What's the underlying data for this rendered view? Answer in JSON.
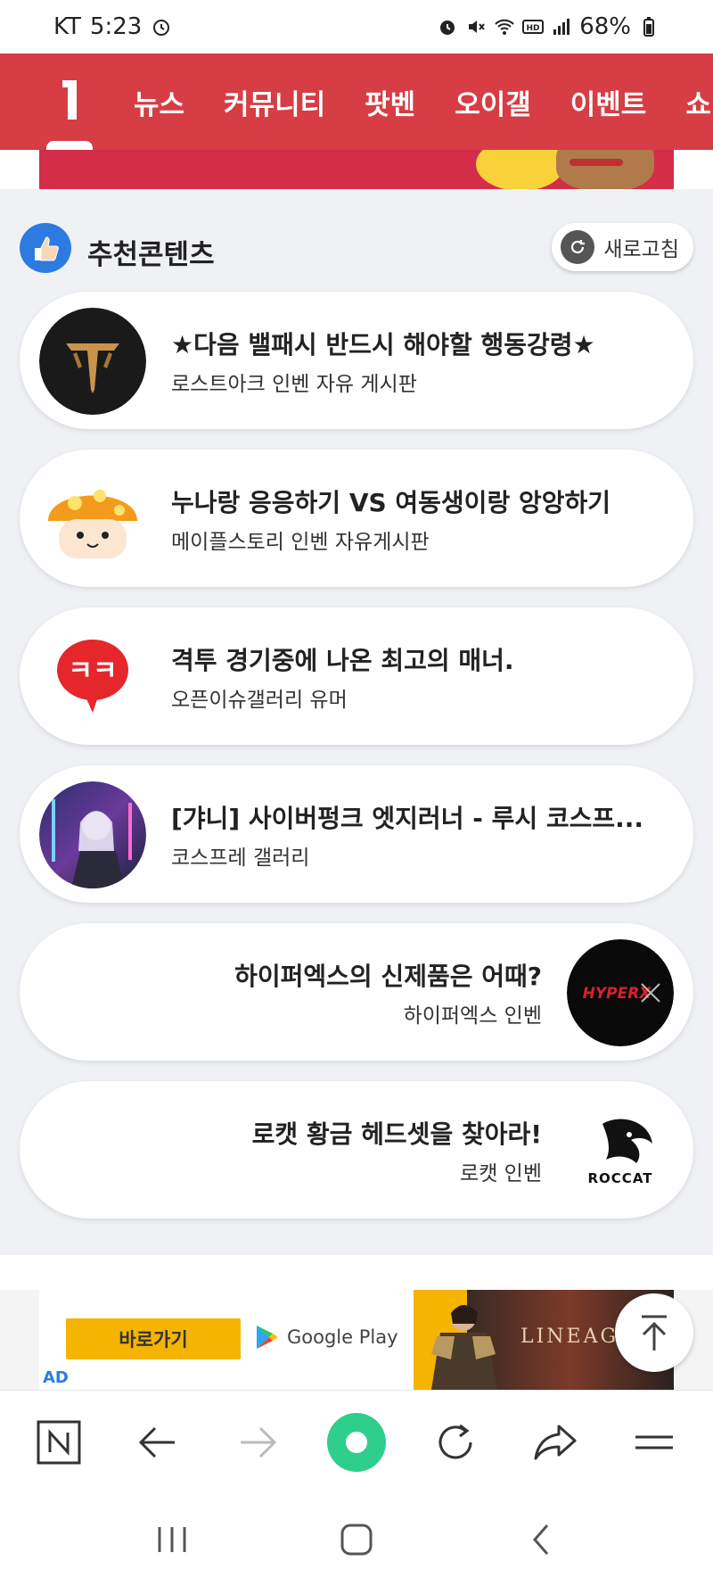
{
  "status_bar": {
    "carrier": "KT",
    "time": "5:23",
    "battery": "68%"
  },
  "nav": {
    "items": [
      "뉴스",
      "커뮤니티",
      "팟벤",
      "오이갤",
      "이벤트",
      "쇼"
    ]
  },
  "recommend": {
    "title": "추천콘텐츠",
    "refresh_label": "새로고침",
    "cards": [
      {
        "title": "★다음 밸패시 반드시 해야할 행동강령★",
        "source": "로스트아크 인벤 자유 게시판"
      },
      {
        "title": "누나랑 응응하기 VS 여동생이랑 앙앙하기",
        "source": "메이플스토리 인벤 자유게시판"
      },
      {
        "title": "격투 경기중에 나온 최고의 매너.",
        "source": "오픈이슈갤러리 유머"
      },
      {
        "title": "[갸니] 사이버펑크 엣지러너 - 루시 코스프...",
        "source": "코스프레 갤러리"
      },
      {
        "title": "하이퍼엑스의 신제품은 어때?",
        "source": "하이퍼엑스 인벤"
      },
      {
        "title": "로캣 황금 헤드셋을 찾아라!",
        "source": "로캣 인벤"
      }
    ],
    "badge_text": "ㅋㅋ",
    "hyperx_logo": "HYPERX",
    "roccat_logo": "ROCCAT"
  },
  "ad": {
    "cta": "바로가기",
    "store": "Google Play",
    "brand": "LINEAGE",
    "label": "AD"
  },
  "toolbar": {
    "icons": [
      "naver-home-icon",
      "back-icon",
      "forward-icon",
      "green-dot-icon",
      "refresh-icon",
      "share-icon",
      "menu-icon"
    ]
  },
  "colors": {
    "nav_bg": "#d63d44",
    "section_bg": "#eff1f5",
    "ad_yellow": "#f4b400",
    "green": "#2ecf8c"
  }
}
